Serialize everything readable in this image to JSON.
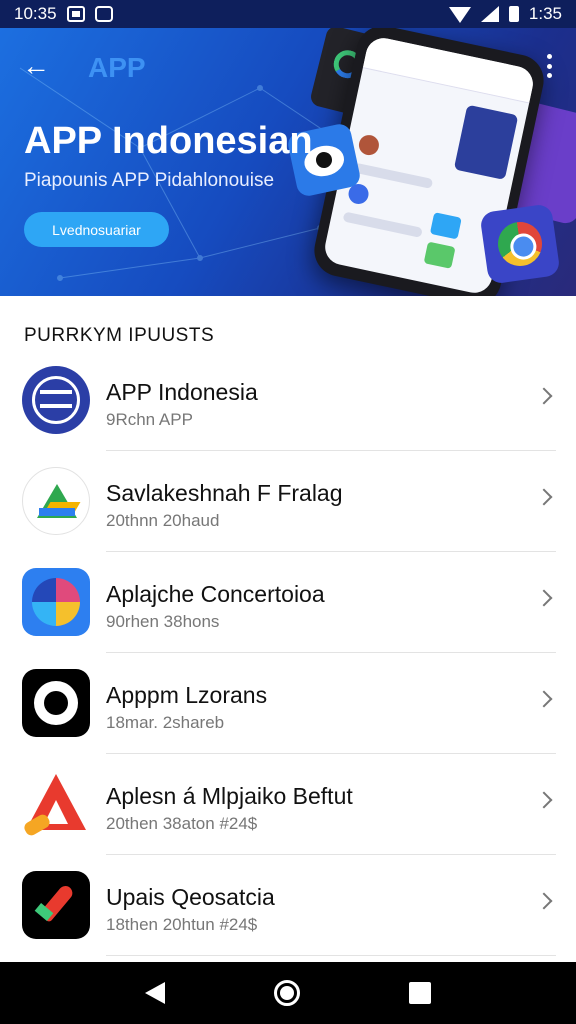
{
  "status_bar": {
    "time_left": "10:35",
    "time_right": "1:35",
    "icons": [
      "photo-icon",
      "app-icon",
      "wifi-icon",
      "signal-icon",
      "battery-icon"
    ]
  },
  "hero": {
    "appbar_title": "APP",
    "title": "APP Indonesian",
    "subtitle": "Piapounis APP Pidahlonouise",
    "button_label": "Lvednosuariar",
    "gradient": [
      "#1c6fe0",
      "#164bbf",
      "#1b2f8e",
      "#2a2a7a"
    ],
    "icons": [
      "back-arrow-icon",
      "more-vert-icon"
    ]
  },
  "section": {
    "header": "PURRKYM IPUUSTS"
  },
  "apps": [
    {
      "name": "APP Indonesia",
      "sub": "9Rchn APP",
      "icon": "app-indonesia-icon"
    },
    {
      "name": "Savlakeshnah F Fralag",
      "sub": "20thnn 20haud",
      "icon": "drive-icon"
    },
    {
      "name": "Aplajche Concertoioa",
      "sub": "90rhen 38hons",
      "icon": "color-circle-icon"
    },
    {
      "name": "Apppm Lzorans",
      "sub": "18mar. 2shareb",
      "icon": "black-circle-icon"
    },
    {
      "name": "Aplesn á Mlpjaiko Beftut",
      "sub": "20then 38aton #24$",
      "icon": "red-triangle-icon"
    },
    {
      "name": "Upais Qeosatcia",
      "sub": "18then 20htun #24$",
      "icon": "rocket-icon"
    }
  ],
  "nav_bar": {
    "icons": [
      "back-triangle-icon",
      "home-circle-icon",
      "recents-square-icon"
    ]
  },
  "colors": {
    "accent": "#2ea6f5",
    "status_bar_bg": "#0e1f5c",
    "nav_bar_bg": "#000000"
  }
}
